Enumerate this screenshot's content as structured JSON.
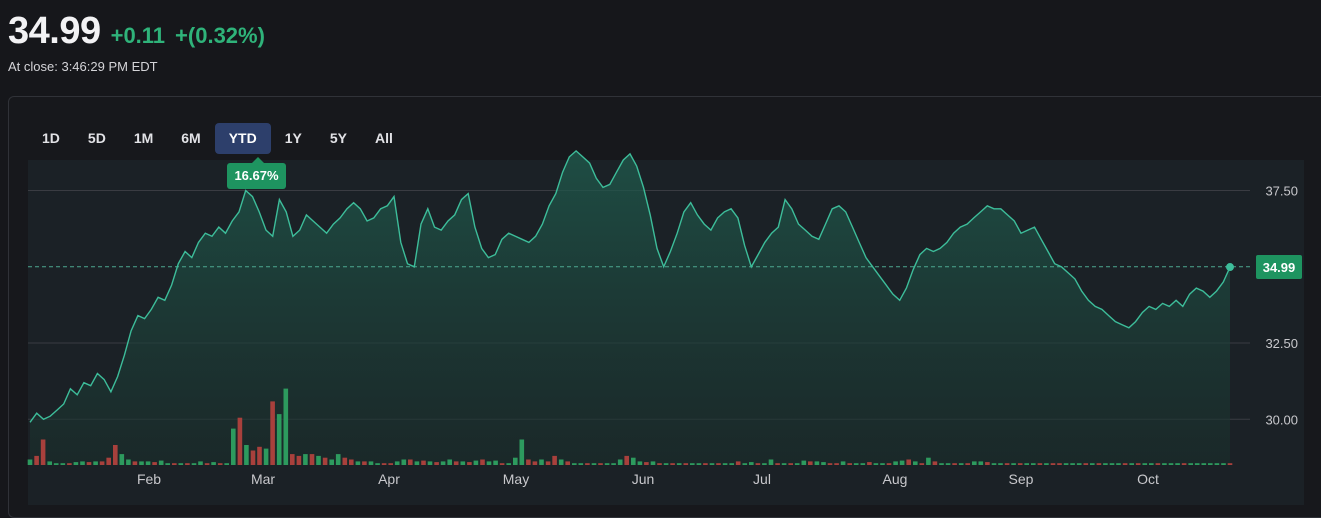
{
  "quote": {
    "price": "34.99",
    "change": "+0.11",
    "change_pct": "+(0.32%)",
    "close_time": "At close: 3:46:29 PM EDT"
  },
  "range_tabs": [
    "1D",
    "5D",
    "1M",
    "6M",
    "YTD",
    "1Y",
    "5Y",
    "All"
  ],
  "active_range": "YTD",
  "range_return": "16.67%",
  "colors": {
    "up": "#2fb37a",
    "down": "#b3403d",
    "line": "#3dbd9a",
    "grid": "#3a3c42",
    "active_tab": "#2d3f6b",
    "badge": "#1e9460"
  },
  "chart_data": {
    "type": "area",
    "title": "",
    "xlabel": "",
    "ylabel": "",
    "x_ticks": [
      "Feb",
      "Mar",
      "Apr",
      "May",
      "Jun",
      "Jul",
      "Aug",
      "Sep",
      "Oct"
    ],
    "y_ticks": [
      "30.00",
      "32.50",
      "37.50"
    ],
    "ylim": [
      28.5,
      38.5
    ],
    "grid": "horizontal",
    "baseline": 35.0,
    "last_value": "34.99",
    "series": [
      {
        "values": [
          29.9,
          30.2,
          30.0,
          30.1,
          30.3,
          30.5,
          31.0,
          30.8,
          31.2,
          31.1,
          31.5,
          31.3,
          30.9,
          31.4,
          32.1,
          32.9,
          33.4,
          33.3,
          33.6,
          34.0,
          33.9,
          34.4,
          35.1,
          35.5,
          35.3,
          35.8,
          36.1,
          36.0,
          36.3,
          36.1,
          36.5,
          36.8,
          37.5,
          37.3,
          36.8,
          36.2,
          36.0,
          37.2,
          36.8,
          36.0,
          36.2,
          36.7,
          36.5,
          36.3,
          36.1,
          36.4,
          36.6,
          36.9,
          37.1,
          36.9,
          36.5,
          36.6,
          36.9,
          37.0,
          37.3,
          35.8,
          35.1,
          35.0,
          36.4,
          36.9,
          36.3,
          36.2,
          36.5,
          36.7,
          37.2,
          37.4,
          36.3,
          35.6,
          35.3,
          35.4,
          35.9,
          36.1,
          36.0,
          35.9,
          35.8,
          36.0,
          36.4,
          37.0,
          37.4,
          38.1,
          38.6,
          38.8,
          38.6,
          38.4,
          37.9,
          37.6,
          37.7,
          38.1,
          38.5,
          38.7,
          38.3,
          37.6,
          36.7,
          35.6,
          35.0,
          35.5,
          36.1,
          36.8,
          37.1,
          36.7,
          36.4,
          36.2,
          36.6,
          36.8,
          36.9,
          36.6,
          35.7,
          35.0,
          35.4,
          35.8,
          36.1,
          36.3,
          37.2,
          36.9,
          36.4,
          36.2,
          36.0,
          35.9,
          36.4,
          36.9,
          37.0,
          36.8,
          36.3,
          35.8,
          35.3,
          35.0,
          34.7,
          34.4,
          34.1,
          33.9,
          34.3,
          34.9,
          35.4,
          35.6,
          35.5,
          35.6,
          35.8,
          36.1,
          36.3,
          36.4,
          36.6,
          36.8,
          37.0,
          36.9,
          36.9,
          36.7,
          36.5,
          36.1,
          36.2,
          36.3,
          35.9,
          35.5,
          35.1,
          35.0,
          34.8,
          34.6,
          34.2,
          33.9,
          33.7,
          33.6,
          33.4,
          33.2,
          33.1,
          33.0,
          33.2,
          33.5,
          33.7,
          33.6,
          33.8,
          33.7,
          33.9,
          33.7,
          34.1,
          34.3,
          34.2,
          34.0,
          34.2,
          34.5,
          34.99
        ]
      }
    ],
    "volume": {
      "values": [
        0.15,
        0.25,
        0.7,
        0.1,
        0.05,
        0.05,
        0.05,
        0.08,
        0.1,
        0.08,
        0.1,
        0.1,
        0.2,
        0.55,
        0.3,
        0.15,
        0.1,
        0.1,
        0.1,
        0.08,
        0.12,
        0.05,
        0.05,
        0.05,
        0.05,
        0.05,
        0.1,
        0.05,
        0.08,
        0.05,
        0.05,
        1.0,
        1.3,
        0.55,
        0.4,
        0.5,
        0.45,
        1.75,
        1.4,
        2.1,
        0.3,
        0.25,
        0.3,
        0.3,
        0.25,
        0.2,
        0.15,
        0.3,
        0.2,
        0.15,
        0.1,
        0.1,
        0.1,
        0.05,
        0.05,
        0.05,
        0.1,
        0.15,
        0.15,
        0.1,
        0.12,
        0.1,
        0.08,
        0.1,
        0.15,
        0.1,
        0.1,
        0.08,
        0.12,
        0.15,
        0.1,
        0.12,
        0.05,
        0.05,
        0.2,
        0.7,
        0.15,
        0.1,
        0.15,
        0.1,
        0.25,
        0.15,
        0.1,
        0.05,
        0.05,
        0.05,
        0.05,
        0.05,
        0.05,
        0.05,
        0.15,
        0.25,
        0.2,
        0.1,
        0.08,
        0.1,
        0.05,
        0.05,
        0.05,
        0.05,
        0.05,
        0.05,
        0.05,
        0.05,
        0.05,
        0.05,
        0.05,
        0.05,
        0.1,
        0.05,
        0.08,
        0.05,
        0.05,
        0.15,
        0.05,
        0.05,
        0.05,
        0.05,
        0.12,
        0.1,
        0.1,
        0.08,
        0.05,
        0.05,
        0.1,
        0.05,
        0.05,
        0.05,
        0.08,
        0.05,
        0.05,
        0.05,
        0.1,
        0.12,
        0.15,
        0.1,
        0.05,
        0.2,
        0.1,
        0.05,
        0.05,
        0.05,
        0.05,
        0.05,
        0.1,
        0.1,
        0.08,
        0.05,
        0.05,
        0.05,
        0.05,
        0.05,
        0.05,
        0.05,
        0.05,
        0.05,
        0.05,
        0.05,
        0.05,
        0.05,
        0.05,
        0.05,
        0.05,
        0.05,
        0.05,
        0.05,
        0.05,
        0.05,
        0.05,
        0.05,
        0.05,
        0.05,
        0.05,
        0.05,
        0.05,
        0.05,
        0.05,
        0.05,
        0.05,
        0.05,
        0.05,
        0.05,
        0.05,
        0.05
      ],
      "up": [
        true,
        false,
        false,
        true,
        true,
        true,
        false,
        true,
        true,
        false,
        true,
        false,
        false,
        false,
        true,
        true,
        false,
        true,
        true,
        false,
        true,
        true,
        false,
        true,
        false,
        true,
        true,
        false,
        true,
        false,
        true,
        true,
        false,
        true,
        false,
        false,
        true,
        false,
        true,
        true,
        false,
        false,
        true,
        false,
        true,
        false,
        true,
        true,
        false,
        false,
        true,
        false,
        true,
        true,
        false,
        false,
        true,
        true,
        false,
        true,
        false,
        true,
        false,
        true,
        true,
        false,
        true,
        false,
        true,
        false,
        true,
        true,
        false,
        true,
        true,
        true,
        false,
        false,
        true,
        false,
        false,
        true,
        false,
        true,
        true,
        false,
        true,
        false,
        true,
        true,
        true,
        false,
        true,
        true,
        false,
        true,
        false,
        true,
        false,
        true,
        false,
        true,
        true,
        false,
        true,
        false,
        true,
        true,
        false,
        true,
        true,
        false,
        true,
        true,
        false,
        true,
        false,
        true,
        true,
        false,
        true,
        true,
        false,
        false,
        true,
        false,
        true,
        true,
        false,
        true,
        true,
        false,
        true,
        true,
        false,
        true,
        false,
        true,
        false,
        true,
        true,
        false,
        true,
        false,
        true,
        true,
        false,
        true,
        true,
        false,
        true,
        false,
        true,
        true,
        false,
        true,
        false,
        false,
        true,
        true,
        true,
        false,
        true,
        false,
        true,
        true,
        true,
        false,
        true,
        false,
        true,
        true,
        false,
        true,
        true,
        true,
        false,
        true,
        true,
        true,
        true,
        true,
        true
      ]
    }
  }
}
